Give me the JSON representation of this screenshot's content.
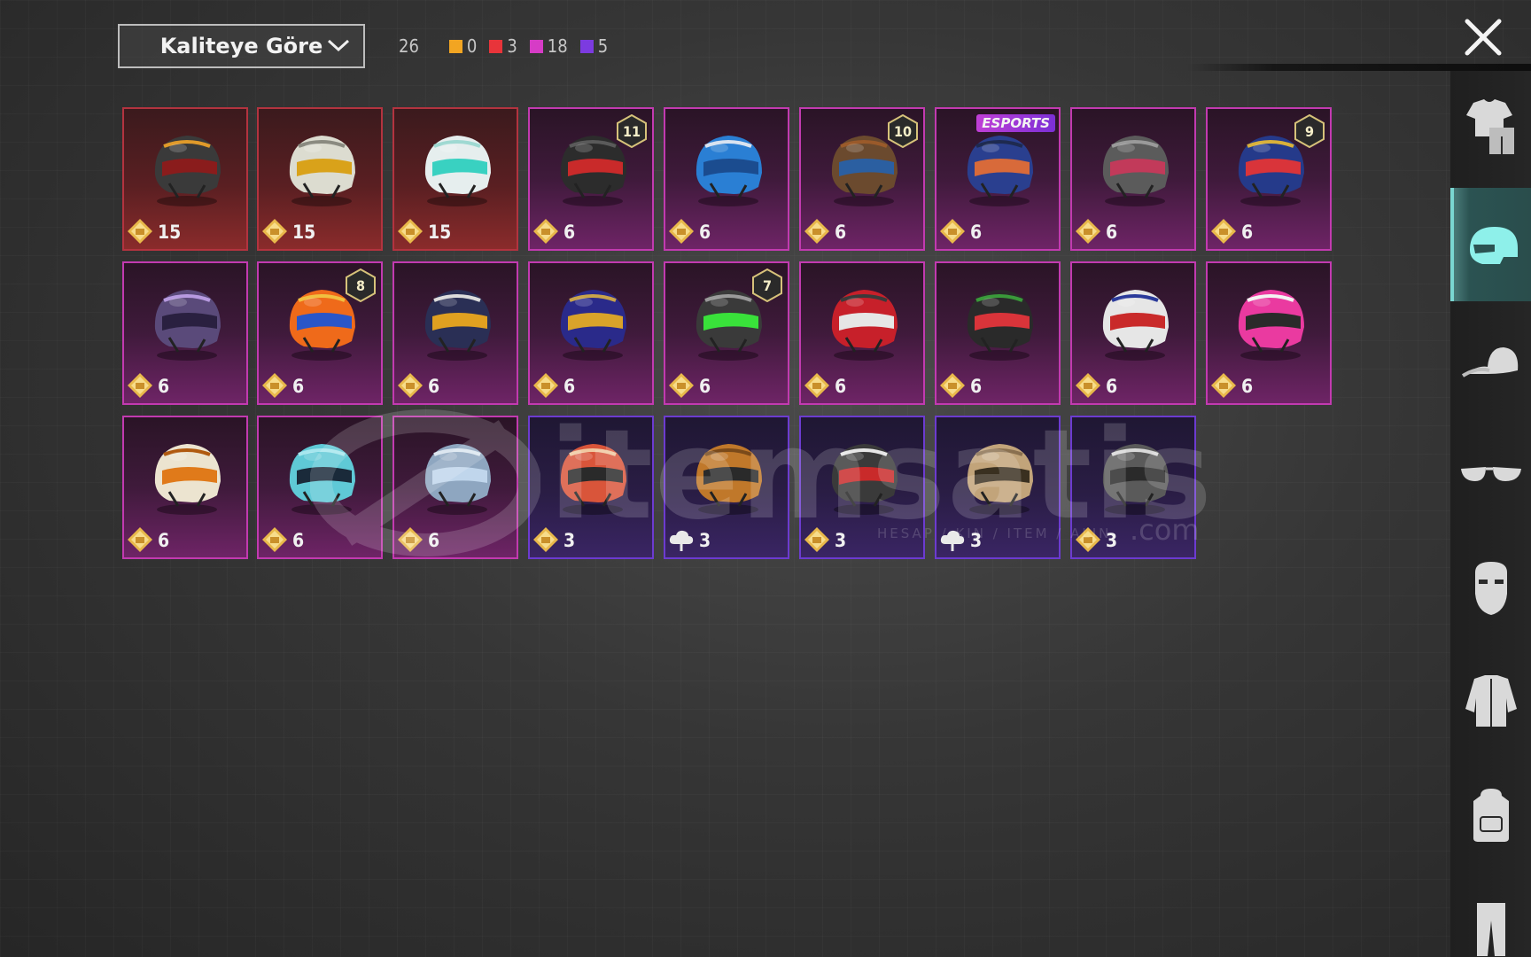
{
  "sort": {
    "label": "Kaliteye Göre"
  },
  "counts": {
    "total": "26",
    "groups": [
      {
        "color": "#f2a522",
        "value": "0"
      },
      {
        "color": "#e8343a",
        "value": "3"
      },
      {
        "color": "#d63cc6",
        "value": "18"
      },
      {
        "color": "#7c3be0",
        "value": "5"
      }
    ]
  },
  "watermark": {
    "brand": "itemsatis",
    "tagline": "HESAP / KIN / ITEM / ALIN",
    "suffix": ".com"
  },
  "sidebar": {
    "tabs": [
      {
        "name": "outfit",
        "active": false
      },
      {
        "name": "helmet",
        "active": true
      },
      {
        "name": "hat",
        "active": false
      },
      {
        "name": "glasses",
        "active": false
      },
      {
        "name": "mask",
        "active": false
      },
      {
        "name": "jacket",
        "active": false
      },
      {
        "name": "backpack",
        "active": false
      },
      {
        "name": "pants",
        "active": false
      }
    ]
  },
  "items": [
    {
      "rarity": "red",
      "value": "15",
      "badge": "coin",
      "helmet": "#3a3a3a",
      "visor": "#8a1c1c",
      "accent": "#e09a2a"
    },
    {
      "rarity": "red",
      "value": "15",
      "badge": "coin",
      "helmet": "#dcdcd0",
      "visor": "#d9a21a",
      "accent": "#8a8a80"
    },
    {
      "rarity": "red",
      "value": "15",
      "badge": "coin",
      "helmet": "#e6eeee",
      "visor": "#39d1c1",
      "accent": "#9fd9d2"
    },
    {
      "rarity": "pink",
      "value": "6",
      "badge": "coin",
      "level": "11",
      "helmet": "#2c2c2c",
      "visor": "#c92a2a",
      "accent": "#5a5a5a"
    },
    {
      "rarity": "pink",
      "value": "6",
      "badge": "coin",
      "helmet": "#2a7fd4",
      "visor": "#1b4c8f",
      "accent": "#d9e3f0"
    },
    {
      "rarity": "pink",
      "value": "6",
      "badge": "coin",
      "level": "10",
      "helmet": "#6b4a2e",
      "visor": "#2b5fa1",
      "accent": "#9a5a2a"
    },
    {
      "rarity": "pink",
      "value": "6",
      "badge": "coin",
      "esports": "ESPORTS",
      "helmet": "#2a3f8f",
      "visor": "#d86a3a",
      "accent": "#1e2a50"
    },
    {
      "rarity": "pink",
      "value": "6",
      "badge": "coin",
      "helmet": "#5b5b5b",
      "visor": "#c23a5a",
      "accent": "#9a9a9a"
    },
    {
      "rarity": "pink",
      "value": "6",
      "badge": "coin",
      "level": "9",
      "helmet": "#253a8a",
      "visor": "#d9343a",
      "accent": "#d9b13a"
    },
    {
      "rarity": "pink",
      "value": "6",
      "badge": "coin",
      "helmet": "#5a4a7a",
      "visor": "#2a2040",
      "accent": "#b79ae0"
    },
    {
      "rarity": "pink",
      "value": "6",
      "badge": "coin",
      "level": "8",
      "helmet": "#ef6a1a",
      "visor": "#2a56c8",
      "accent": "#f0c040"
    },
    {
      "rarity": "pink",
      "value": "6",
      "badge": "coin",
      "helmet": "#2a2f55",
      "visor": "#e0a020",
      "accent": "#dcdcdc"
    },
    {
      "rarity": "pink",
      "value": "6",
      "badge": "coin",
      "helmet": "#2a2a8a",
      "visor": "#d9a32a",
      "accent": "#c9a44a"
    },
    {
      "rarity": "pink",
      "value": "6",
      "badge": "coin",
      "level": "7",
      "helmet": "#3a3a3a",
      "visor": "#39e23a",
      "accent": "#9a9a9a"
    },
    {
      "rarity": "pink",
      "value": "6",
      "badge": "coin",
      "helmet": "#c7202a",
      "visor": "#e6e6e6",
      "accent": "#3a3a3a"
    },
    {
      "rarity": "pink",
      "value": "6",
      "badge": "coin",
      "helmet": "#2a2a2a",
      "visor": "#d9343a",
      "accent": "#3a9a3a"
    },
    {
      "rarity": "pink",
      "value": "6",
      "badge": "coin",
      "helmet": "#e6e6e6",
      "visor": "#c92a2a",
      "accent": "#2a3a9a"
    },
    {
      "rarity": "pink",
      "value": "6",
      "badge": "coin",
      "helmet": "#ea3aa0",
      "visor": "#2a2a2a",
      "accent": "#f3f3f3"
    },
    {
      "rarity": "pink",
      "value": "6",
      "badge": "coin",
      "helmet": "#ece4d0",
      "visor": "#e07a1a",
      "accent": "#b05a10"
    },
    {
      "rarity": "pink",
      "value": "6",
      "badge": "coin",
      "helmet": "#5fc9d6",
      "visor": "#1a2a3a",
      "accent": "#a6e6ee"
    },
    {
      "rarity": "pink",
      "value": "6",
      "badge": "coin",
      "helmet": "#8ea6c0",
      "visor": "#c0d6ec",
      "accent": "#dce6f0"
    },
    {
      "rarity": "purple",
      "value": "3",
      "badge": "coin",
      "helmet": "#d9553a",
      "visor": "#2a2a2a",
      "accent": "#f0c8a0"
    },
    {
      "rarity": "purple",
      "value": "3",
      "badge": "cloud",
      "helmet": "#c0782a",
      "visor": "#2a2a2a",
      "accent": "#7a4a1a"
    },
    {
      "rarity": "purple",
      "value": "3",
      "badge": "coin",
      "helmet": "#3a3a3a",
      "visor": "#c92a2a",
      "accent": "#e6e6e6"
    },
    {
      "rarity": "purple",
      "value": "3",
      "badge": "cloud",
      "helmet": "#c2a47a",
      "visor": "#3a3020",
      "accent": "#8a7050"
    },
    {
      "rarity": "purple",
      "value": "3",
      "badge": "coin",
      "helmet": "#5a5a5a",
      "visor": "#2a2a2a",
      "accent": "#d9d9d9"
    }
  ]
}
